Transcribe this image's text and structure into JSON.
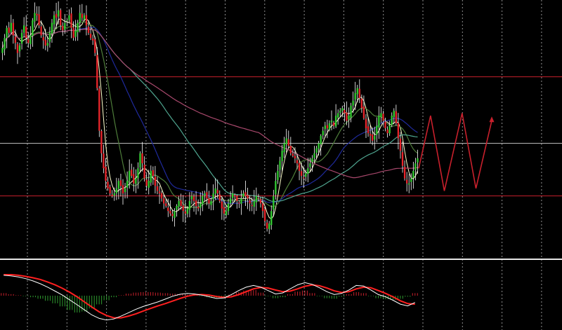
{
  "colors": {
    "background": "#000000",
    "grid": "#bfbfbf",
    "candle_up": "#33cc33",
    "candle_down": "#e8252b",
    "wick": "#ffffff",
    "ma_fast": "#ffffcc",
    "ma_mid": "#4e7d3a",
    "ma_blue": "#1f2a9c",
    "ma_teal": "#4fa58f",
    "ma_pink": "#a8486c",
    "resistance": "#c8202c",
    "support": "#c8202c",
    "pivot": "#b9b9b9",
    "separator": "#e6e6e6",
    "projection": "#c8202c",
    "macd_main": "#ffffff",
    "macd_signal": "#ff2020",
    "hist_up": "#c8202c",
    "hist_down": "#2f9a2f"
  },
  "chart_data": [
    {
      "type": "candlestick",
      "panel": "price",
      "title": "",
      "xlabel": "",
      "ylabel": "",
      "ylim": [
        0,
        100
      ],
      "grid": true,
      "horizontal_levels": [
        {
          "name": "",
          "value": 70.5,
          "color_key": "resistance"
        },
        {
          "name": "",
          "value": 44.0,
          "color_key": "pivot"
        },
        {
          "name": "",
          "value": 23.0,
          "color_key": "support"
        }
      ],
      "candles_close": [
        82,
        86,
        90,
        88,
        92,
        87,
        84,
        80,
        83,
        88,
        91,
        86,
        84,
        87,
        93,
        96,
        95,
        91,
        87,
        85,
        83,
        84,
        88,
        92,
        95,
        94,
        97,
        91,
        89,
        92,
        93,
        95,
        90,
        86,
        89,
        92,
        96,
        94,
        95,
        91,
        88,
        86,
        85,
        80,
        66,
        49,
        40,
        34,
        29,
        26,
        24,
        23,
        24,
        26,
        29,
        27,
        24,
        26,
        29,
        33,
        31,
        28,
        30,
        34,
        40,
        36,
        30,
        27,
        29,
        33,
        31,
        27,
        25,
        24,
        22,
        20,
        19,
        17,
        16,
        15,
        17,
        19,
        21,
        19,
        17,
        16,
        18,
        21,
        23,
        21,
        19,
        18,
        20,
        23,
        24,
        22,
        20,
        21,
        24,
        26,
        24,
        21,
        18,
        16,
        17,
        20,
        22,
        24,
        23,
        21,
        20,
        22,
        24,
        23,
        22,
        20,
        19,
        21,
        23,
        22,
        20,
        17,
        13,
        10,
        12,
        17,
        23,
        29,
        33,
        37,
        41,
        44,
        46,
        43,
        40,
        39,
        38,
        36,
        33,
        31,
        30,
        32,
        34,
        36,
        38,
        40,
        42,
        44,
        47,
        49,
        51,
        50,
        52,
        53,
        51,
        55,
        56,
        57,
        58,
        56,
        53,
        55,
        59,
        61,
        64,
        66,
        62,
        58,
        54,
        50,
        48,
        47,
        45,
        47,
        51,
        55,
        56,
        53,
        50,
        48,
        51,
        55,
        57,
        52,
        46,
        41,
        35,
        30,
        28,
        28,
        30,
        33,
        36,
        38
      ],
      "overlays": [
        {
          "name": "",
          "period": 5,
          "color_key": "ma_fast"
        },
        {
          "name": "",
          "period": 14,
          "color_key": "ma_mid"
        },
        {
          "name": "",
          "period": 34,
          "color_key": "ma_blue"
        },
        {
          "name": "",
          "period": 60,
          "color_key": "ma_teal"
        },
        {
          "name": "",
          "period": 120,
          "color_key": "ma_pink"
        }
      ],
      "projection_path": [
        {
          "x": 0,
          "y": 34
        },
        {
          "x": 6,
          "y": 55
        },
        {
          "x": 13,
          "y": 25
        },
        {
          "x": 22,
          "y": 56
        },
        {
          "x": 29,
          "y": 26
        },
        {
          "x": 37,
          "y": 53
        }
      ]
    },
    {
      "type": "macd",
      "panel": "oscillator",
      "title": "",
      "ylim": [
        -1,
        1
      ],
      "main": [
        0.72,
        0.7,
        0.66,
        0.6,
        0.52,
        0.42,
        0.3,
        0.16,
        0.02,
        -0.15,
        -0.32,
        -0.5,
        -0.68,
        -0.8,
        -0.86,
        -0.82,
        -0.72,
        -0.6,
        -0.48,
        -0.38,
        -0.3,
        -0.22,
        -0.12,
        -0.02,
        0.05,
        0.08,
        0.06,
        0.02,
        -0.04,
        -0.1,
        -0.08,
        0.04,
        0.18,
        0.3,
        0.36,
        0.3,
        0.18,
        0.06,
        0.1,
        0.24,
        0.38,
        0.46,
        0.4,
        0.28,
        0.14,
        0.04,
        0.08,
        0.2,
        0.36,
        0.34,
        0.2,
        0.04,
        -0.04,
        -0.16,
        -0.3,
        -0.36,
        -0.24
      ],
      "signal": [
        0.74,
        0.74,
        0.72,
        0.68,
        0.63,
        0.57,
        0.48,
        0.38,
        0.26,
        0.12,
        -0.04,
        -0.22,
        -0.4,
        -0.57,
        -0.7,
        -0.78,
        -0.78,
        -0.72,
        -0.64,
        -0.54,
        -0.45,
        -0.36,
        -0.28,
        -0.19,
        -0.1,
        -0.02,
        0.03,
        0.04,
        0.02,
        -0.03,
        -0.06,
        -0.04,
        0.04,
        0.14,
        0.24,
        0.29,
        0.27,
        0.2,
        0.14,
        0.16,
        0.24,
        0.33,
        0.38,
        0.35,
        0.27,
        0.17,
        0.11,
        0.14,
        0.24,
        0.3,
        0.28,
        0.18,
        0.08,
        -0.04,
        -0.18,
        -0.28,
        -0.3
      ],
      "histogram": [
        0.1,
        0.06,
        0.02,
        -0.02,
        -0.06,
        -0.12,
        -0.2,
        -0.3,
        -0.42,
        -0.56,
        -0.66,
        -0.62,
        -0.5,
        -0.34,
        -0.18,
        -0.06,
        0.02,
        0.08,
        0.12,
        0.14,
        0.14,
        0.12,
        0.1,
        0.08,
        0.06,
        0.04,
        0.02,
        -0.02,
        -0.06,
        -0.08,
        -0.04,
        0.04,
        0.14,
        0.2,
        0.22,
        0.12,
        -0.02,
        -0.1,
        -0.06,
        0.06,
        0.16,
        0.2,
        0.1,
        -0.02,
        -0.1,
        -0.12,
        -0.04,
        0.06,
        0.14,
        0.1,
        -0.02,
        -0.1,
        -0.14,
        -0.16,
        -0.12,
        -0.04,
        0.1
      ]
    }
  ]
}
